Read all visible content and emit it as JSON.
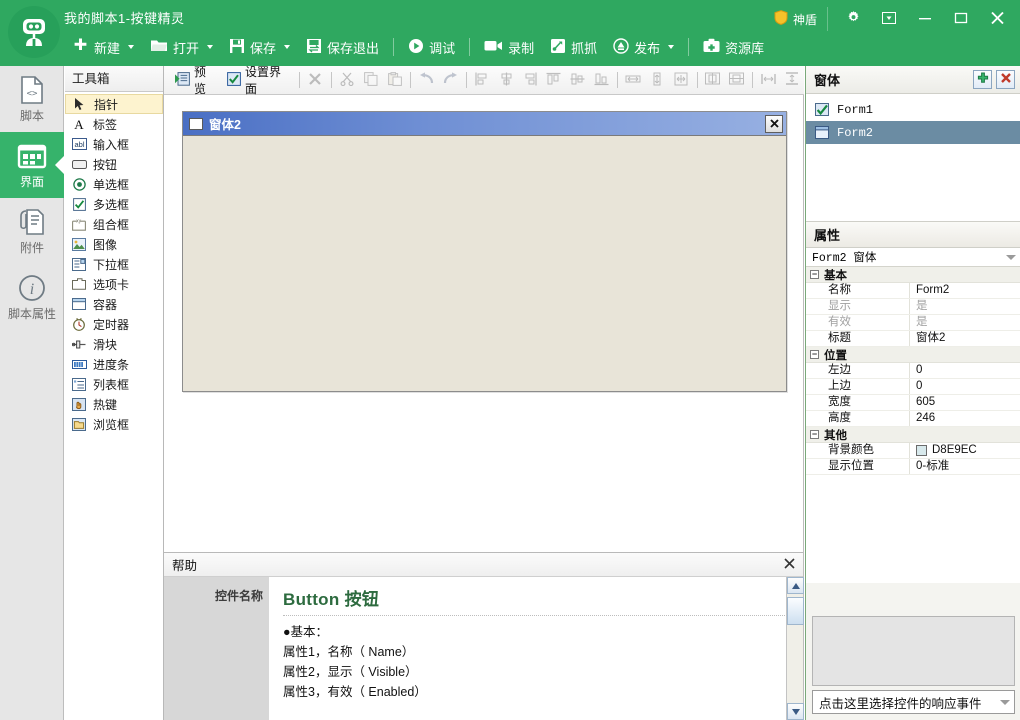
{
  "titlebar": {
    "app_title": "我的脚本1-按键精灵",
    "logo_icon": "robot-logo-icon",
    "shield": {
      "label": "神盾",
      "icon": "shield-icon"
    },
    "window_controls": [
      {
        "name": "settings-button",
        "icon": "gear-icon"
      },
      {
        "name": "dropdown-button",
        "icon": "box-arrow-down-icon"
      },
      {
        "name": "minimize-button",
        "icon": "minimize-icon"
      },
      {
        "name": "maximize-button",
        "icon": "maximize-icon"
      },
      {
        "name": "close-button",
        "icon": "close-icon"
      }
    ],
    "accent_color": "#2fa860"
  },
  "main_toolbar": {
    "items": [
      {
        "label": "新建",
        "icon": "plus-icon",
        "caret": true
      },
      {
        "label": "打开",
        "icon": "folder-icon",
        "caret": true
      },
      {
        "label": "保存",
        "icon": "save-icon",
        "caret": true
      },
      {
        "label": "保存退出",
        "icon": "save-exit-icon",
        "caret": false
      },
      {
        "label": "调试",
        "icon": "play-icon",
        "caret": false
      },
      {
        "label": "录制",
        "icon": "camera-icon",
        "caret": false
      },
      {
        "label": "抓抓",
        "icon": "grab-icon",
        "caret": false
      },
      {
        "label": "发布",
        "icon": "publish-icon",
        "caret": true
      },
      {
        "label": "资源库",
        "icon": "library-icon",
        "caret": false
      }
    ]
  },
  "rail": {
    "items": [
      {
        "label": "脚本",
        "icon": "script-file-icon",
        "active": false
      },
      {
        "label": "界面",
        "icon": "ui-grid-icon",
        "active": true
      },
      {
        "label": "附件",
        "icon": "attachment-icon",
        "active": false
      },
      {
        "label": "脚本属性",
        "icon": "info-circle-icon",
        "active": false
      }
    ]
  },
  "toolbox": {
    "title": "工具箱",
    "items": [
      {
        "label": "指针",
        "icon": "pointer-icon",
        "selected": true
      },
      {
        "label": "标签",
        "icon": "label-icon",
        "selected": false
      },
      {
        "label": "输入框",
        "icon": "textbox-icon",
        "selected": false
      },
      {
        "label": "按钮",
        "icon": "button-icon",
        "selected": false
      },
      {
        "label": "单选框",
        "icon": "radio-icon",
        "selected": false
      },
      {
        "label": "多选框",
        "icon": "checkbox-icon",
        "selected": false
      },
      {
        "label": "组合框",
        "icon": "groupbox-icon",
        "selected": false
      },
      {
        "label": "图像",
        "icon": "image-icon",
        "selected": false
      },
      {
        "label": "下拉框",
        "icon": "combobox-icon",
        "selected": false
      },
      {
        "label": "选项卡",
        "icon": "tab-icon",
        "selected": false
      },
      {
        "label": "容器",
        "icon": "container-icon",
        "selected": false
      },
      {
        "label": "定时器",
        "icon": "timer-icon",
        "selected": false
      },
      {
        "label": "滑块",
        "icon": "slider-icon",
        "selected": false
      },
      {
        "label": "进度条",
        "icon": "progressbar-icon",
        "selected": false
      },
      {
        "label": "列表框",
        "icon": "listbox-icon",
        "selected": false
      },
      {
        "label": "热键",
        "icon": "hotkey-icon",
        "selected": false
      },
      {
        "label": "浏览框",
        "icon": "browser-icon",
        "selected": false
      }
    ]
  },
  "designer_toolbar": {
    "preview": {
      "label": "预览",
      "icon": "preview-play-icon"
    },
    "setup_ui": {
      "label": "设置界面",
      "icon": "check-square-icon"
    },
    "tools": [
      {
        "name": "delete-button",
        "icon": "delete-x-icon",
        "disabled": true
      },
      {
        "name": "cut-button",
        "icon": "scissors-icon",
        "disabled": true
      },
      {
        "name": "copy-button",
        "icon": "copy-icon",
        "disabled": true
      },
      {
        "name": "paste-button",
        "icon": "paste-icon",
        "disabled": true
      },
      {
        "name": "undo-button",
        "icon": "undo-arrow-icon",
        "disabled": true
      },
      {
        "name": "redo-button",
        "icon": "redo-arrow-icon",
        "disabled": true
      },
      {
        "name": "align-left-button",
        "icon": "align-left-icon",
        "disabled": true
      },
      {
        "name": "align-center-button",
        "icon": "align-center-icon",
        "disabled": true
      },
      {
        "name": "align-right-button",
        "icon": "align-right-icon",
        "disabled": true
      },
      {
        "name": "align-top-button",
        "icon": "align-top-icon",
        "disabled": true
      },
      {
        "name": "align-middle-button",
        "icon": "align-middle-icon",
        "disabled": true
      },
      {
        "name": "align-bottom-button",
        "icon": "align-bottom-icon",
        "disabled": true
      },
      {
        "name": "same-width-button",
        "icon": "same-width-icon",
        "disabled": true
      },
      {
        "name": "same-height-button",
        "icon": "same-height-icon",
        "disabled": true
      },
      {
        "name": "same-size-button",
        "icon": "same-size-icon",
        "disabled": true
      },
      {
        "name": "center-horizontal-button",
        "icon": "center-h-icon",
        "disabled": true
      },
      {
        "name": "center-vertical-button",
        "icon": "center-v-icon",
        "disabled": true
      },
      {
        "name": "space-horizontal-button",
        "icon": "space-h-icon",
        "disabled": true
      },
      {
        "name": "space-vertical-button",
        "icon": "space-v-icon",
        "disabled": true
      }
    ]
  },
  "designer": {
    "form": {
      "title": "窗体2",
      "close_icon": "close-icon",
      "window_icon": "form-window-icon",
      "background_color": "#E8E4D8"
    }
  },
  "help": {
    "title": "帮助",
    "close_icon": "close-icon",
    "left_label": "控件名称",
    "heading": "Button 按钮",
    "lines": [
      "●基本：",
      "属性1，名称（ Name）",
      "属性2，显示（ Visible）",
      "属性3，有效（ Enabled）"
    ]
  },
  "right_panel": {
    "forms": {
      "title": "窗体",
      "add_icon": "add-plus-icon",
      "delete_icon": "delete-x-icon",
      "items": [
        {
          "label": "Form1",
          "icon": "form-checked-icon",
          "selected": false
        },
        {
          "label": "Form2",
          "icon": "form-window-icon",
          "selected": true
        }
      ]
    },
    "properties": {
      "title": "属性",
      "selected_object": "Form2 窗体",
      "groups": [
        {
          "name": "基本",
          "rows": [
            {
              "key": "名称",
              "value": "Form2",
              "dim": false
            },
            {
              "key": "显示",
              "value": "是",
              "dim": true
            },
            {
              "key": "有效",
              "value": "是",
              "dim": true
            },
            {
              "key": "标题",
              "value": "窗体2",
              "dim": false
            }
          ]
        },
        {
          "name": "位置",
          "rows": [
            {
              "key": "左边",
              "value": "0",
              "dim": false
            },
            {
              "key": "上边",
              "value": "0",
              "dim": false
            },
            {
              "key": "宽度",
              "value": "605",
              "dim": false
            },
            {
              "key": "高度",
              "value": "246",
              "dim": false
            }
          ]
        },
        {
          "name": "其他",
          "rows": [
            {
              "key": "背景颜色",
              "value": "D8E9EC",
              "dim": false,
              "swatch": "#D8E9EC"
            },
            {
              "key": "显示位置",
              "value": "0-标准",
              "dim": false
            }
          ]
        }
      ]
    },
    "event_selector": {
      "placeholder": "点击这里选择控件的响应事件",
      "caret_icon": "chevron-down-icon"
    }
  }
}
